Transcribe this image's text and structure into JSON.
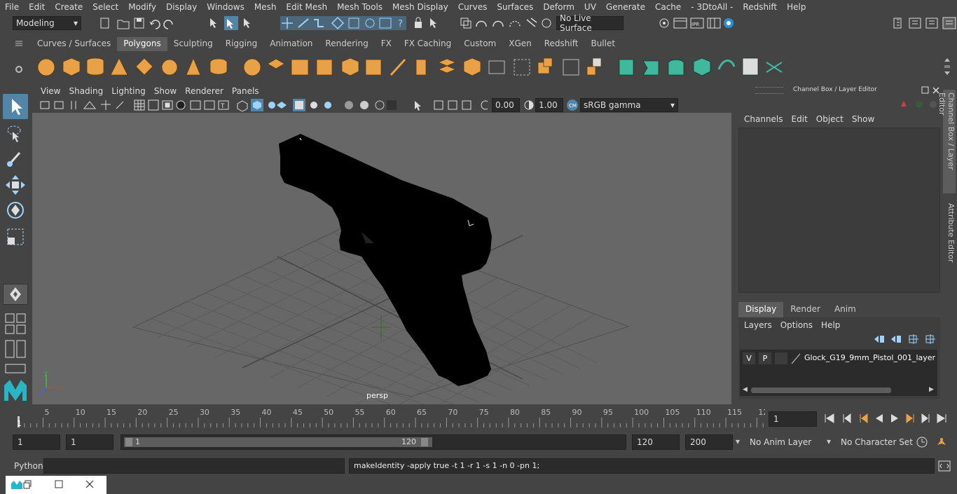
{
  "menu": [
    "File",
    "Edit",
    "Create",
    "Select",
    "Modify",
    "Display",
    "Windows",
    "Mesh",
    "Edit Mesh",
    "Mesh Tools",
    "Mesh Display",
    "Curves",
    "Surfaces",
    "Deform",
    "UV",
    "Generate",
    "Cache",
    "- 3DtoAll -",
    "Redshift",
    "Help"
  ],
  "status": {
    "mode": "Modeling",
    "live_surface": "No Live Surface"
  },
  "shelf_tabs": [
    "Curves / Surfaces",
    "Polygons",
    "Sculpting",
    "Rigging",
    "Animation",
    "Rendering",
    "FX",
    "FX Caching",
    "Custom",
    "XGen",
    "Redshift",
    "Bullet"
  ],
  "active_shelf_tab": "Polygons",
  "viewport": {
    "menu": [
      "View",
      "Shading",
      "Lighting",
      "Show",
      "Renderer",
      "Panels"
    ],
    "near": "0.00",
    "far": "1.00",
    "color_space": "sRGB gamma",
    "camera": "persp"
  },
  "channel_box": {
    "title": "Channel Box / Layer Editor",
    "menu": [
      "Channels",
      "Edit",
      "Object",
      "Show"
    ],
    "layer_tabs": [
      "Display",
      "Render",
      "Anim"
    ],
    "active_layer_tab": "Display",
    "layer_menu": [
      "Layers",
      "Options",
      "Help"
    ],
    "layer": {
      "v": "V",
      "p": "P",
      "name": "Glock_G19_9mm_Pistol_001_layer"
    }
  },
  "side_tabs": [
    "Channel Box / Layer Editor",
    "Attribute Editor"
  ],
  "timeline": {
    "ticks": [
      "5",
      "10",
      "15",
      "20",
      "25",
      "30",
      "35",
      "40",
      "45",
      "50",
      "55",
      "60",
      "65",
      "70",
      "75",
      "80",
      "85",
      "90",
      "95",
      "100",
      "105",
      "110",
      "115",
      "12"
    ],
    "start_label": "1",
    "current_frame": "1"
  },
  "range": {
    "start": "1",
    "start2": "1",
    "slider_start": "1",
    "slider_end": "120",
    "end": "120",
    "end2": "200",
    "anim_layer": "No Anim Layer",
    "char_set": "No Character Set"
  },
  "command": {
    "lang": "Python",
    "result": "makeIdentity -apply true -t 1 -r 1 -s 1 -n 0 -pn 1;"
  },
  "colors": {
    "accent": "#5285a6",
    "shelf_orange": "#e8a146",
    "shelf_teal": "#3fb89c"
  }
}
